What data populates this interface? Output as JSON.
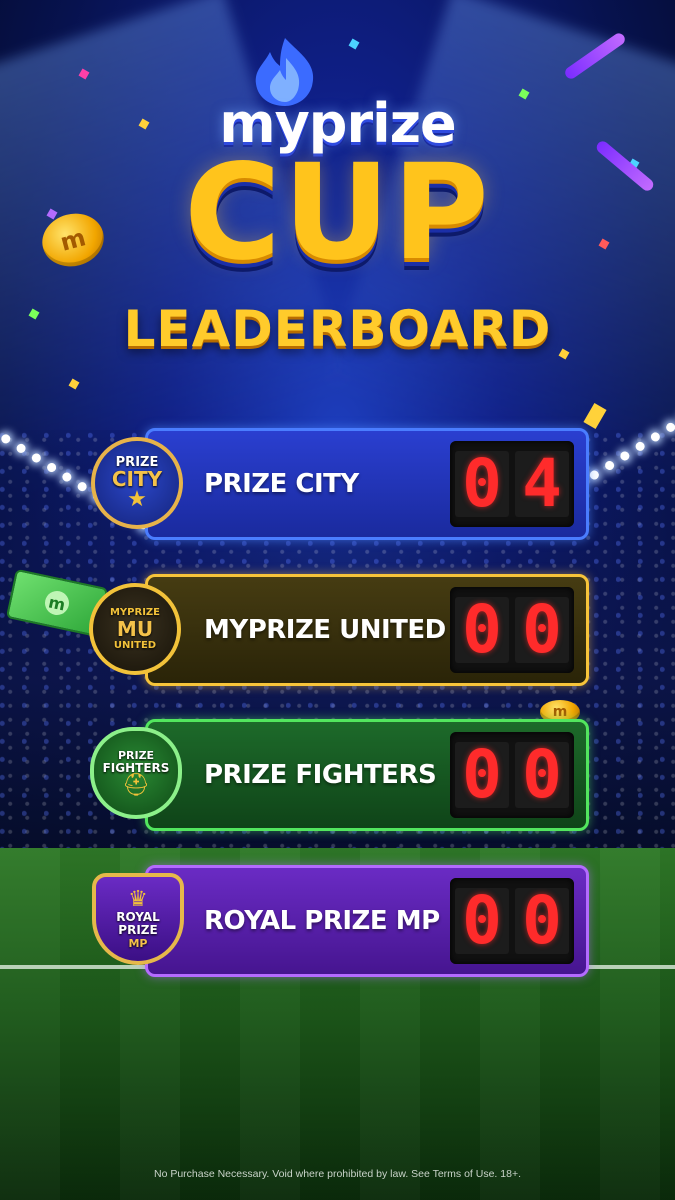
{
  "brand": {
    "logo_text": "myprize",
    "cup_text": "CUP",
    "title": "LEADERBOARD"
  },
  "teams": [
    {
      "name": "PRIZE CITY",
      "score_digits": [
        "0",
        "4"
      ],
      "crest": {
        "top": "PRIZE",
        "bottom": "CITY",
        "icon": "star-icon"
      },
      "accent": "#4a7dff"
    },
    {
      "name": "MYPRIZE UNITED",
      "score_digits": [
        "0",
        "0"
      ],
      "crest": {
        "top": "MYPRIZE",
        "mono": "MU",
        "bottom": "UNITED"
      },
      "accent": "#f7c43a"
    },
    {
      "name": "PRIZE FIGHTERS",
      "score_digits": [
        "0",
        "0"
      ],
      "crest": {
        "top": "PRIZE",
        "bottom": "FIGHTERS",
        "icon": "helmet-icon"
      },
      "accent": "#52e65e"
    },
    {
      "name": "ROYAL PRIZE MP",
      "score_digits": [
        "0",
        "0"
      ],
      "crest": {
        "top": "ROYAL",
        "middle": "PRIZE",
        "bottom": "MP",
        "icon": "crown-icon"
      },
      "accent": "#b46bff"
    }
  ],
  "coin_letter": "m",
  "disclaimer": "No Purchase Necessary. Void where prohibited by law. See Terms of Use. 18+."
}
